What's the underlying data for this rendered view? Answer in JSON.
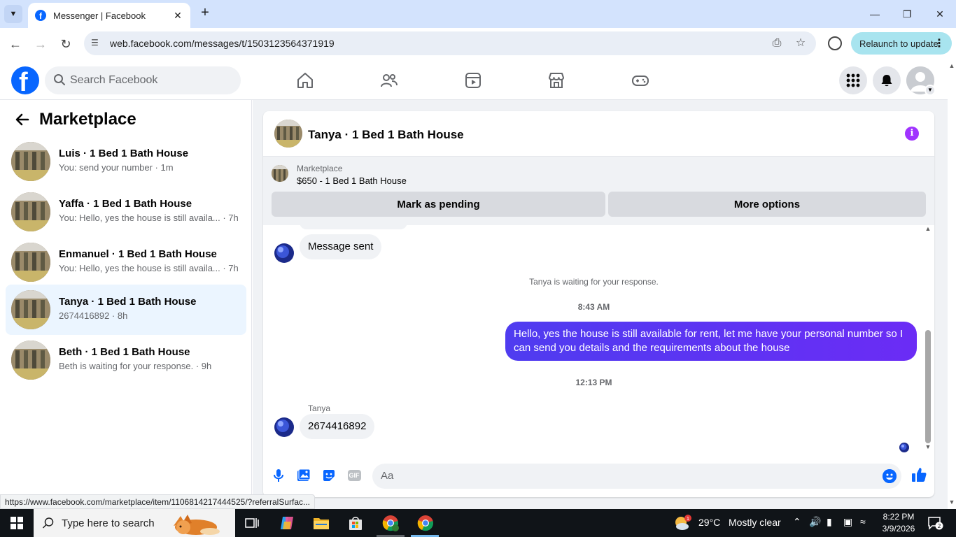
{
  "browser": {
    "tab_title": "Messenger | Facebook",
    "url": "web.facebook.com/messages/t/1503123564371919",
    "relaunch_label": "Relaunch to update",
    "status_url": "https://www.facebook.com/marketplace/item/1106814217444525/?referralSurfac..."
  },
  "fb": {
    "search_placeholder": "Search Facebook",
    "logo_letter": "f",
    "brand_color": "#0866ff"
  },
  "sidebar": {
    "title": "Marketplace",
    "conversations": [
      {
        "name": "Luis · 1 Bed 1 Bath House",
        "preview": "You: send your number · 1m",
        "active": false
      },
      {
        "name": "Yaffa · 1 Bed 1 Bath House",
        "preview": "You: Hello, yes the house is still availa... · 7h",
        "active": false
      },
      {
        "name": "Enmanuel · 1 Bed 1 Bath House",
        "preview": "You: Hello, yes the house is still availa... · 7h",
        "active": false
      },
      {
        "name": "Tanya · 1 Bed 1 Bath House",
        "preview": "2674416892 · 8h",
        "active": true
      },
      {
        "name": "Beth · 1 Bed 1 Bath House",
        "preview": "Beth is waiting for your response. · 9h",
        "active": false
      }
    ]
  },
  "chat": {
    "title": "Tanya · 1 Bed 1 Bath House",
    "marketplace_label": "Marketplace",
    "listing": "$650 - 1 Bed 1 Bath House",
    "mark_pending": "Mark as pending",
    "more_options": "More options",
    "messages": {
      "incoming_1": "Message sent",
      "system_waiting": "Tanya is waiting for your response.",
      "time_1": "8:43 AM",
      "outgoing_1": "Hello, yes the house is still available for rent, let me have your personal number so I can send you details and the requirements about the house",
      "time_2": "12:13 PM",
      "sender_name": "Tanya",
      "incoming_2": "2674416892"
    },
    "composer_placeholder": "Aa",
    "gif_label": "GIF"
  },
  "taskbar": {
    "search_placeholder": "Type here to search",
    "temperature": "29°C",
    "weather": "Mostly clear",
    "weather_badge": "1",
    "time": "8:22 PM",
    "date": "3/9/2026",
    "notification_count": "2"
  }
}
